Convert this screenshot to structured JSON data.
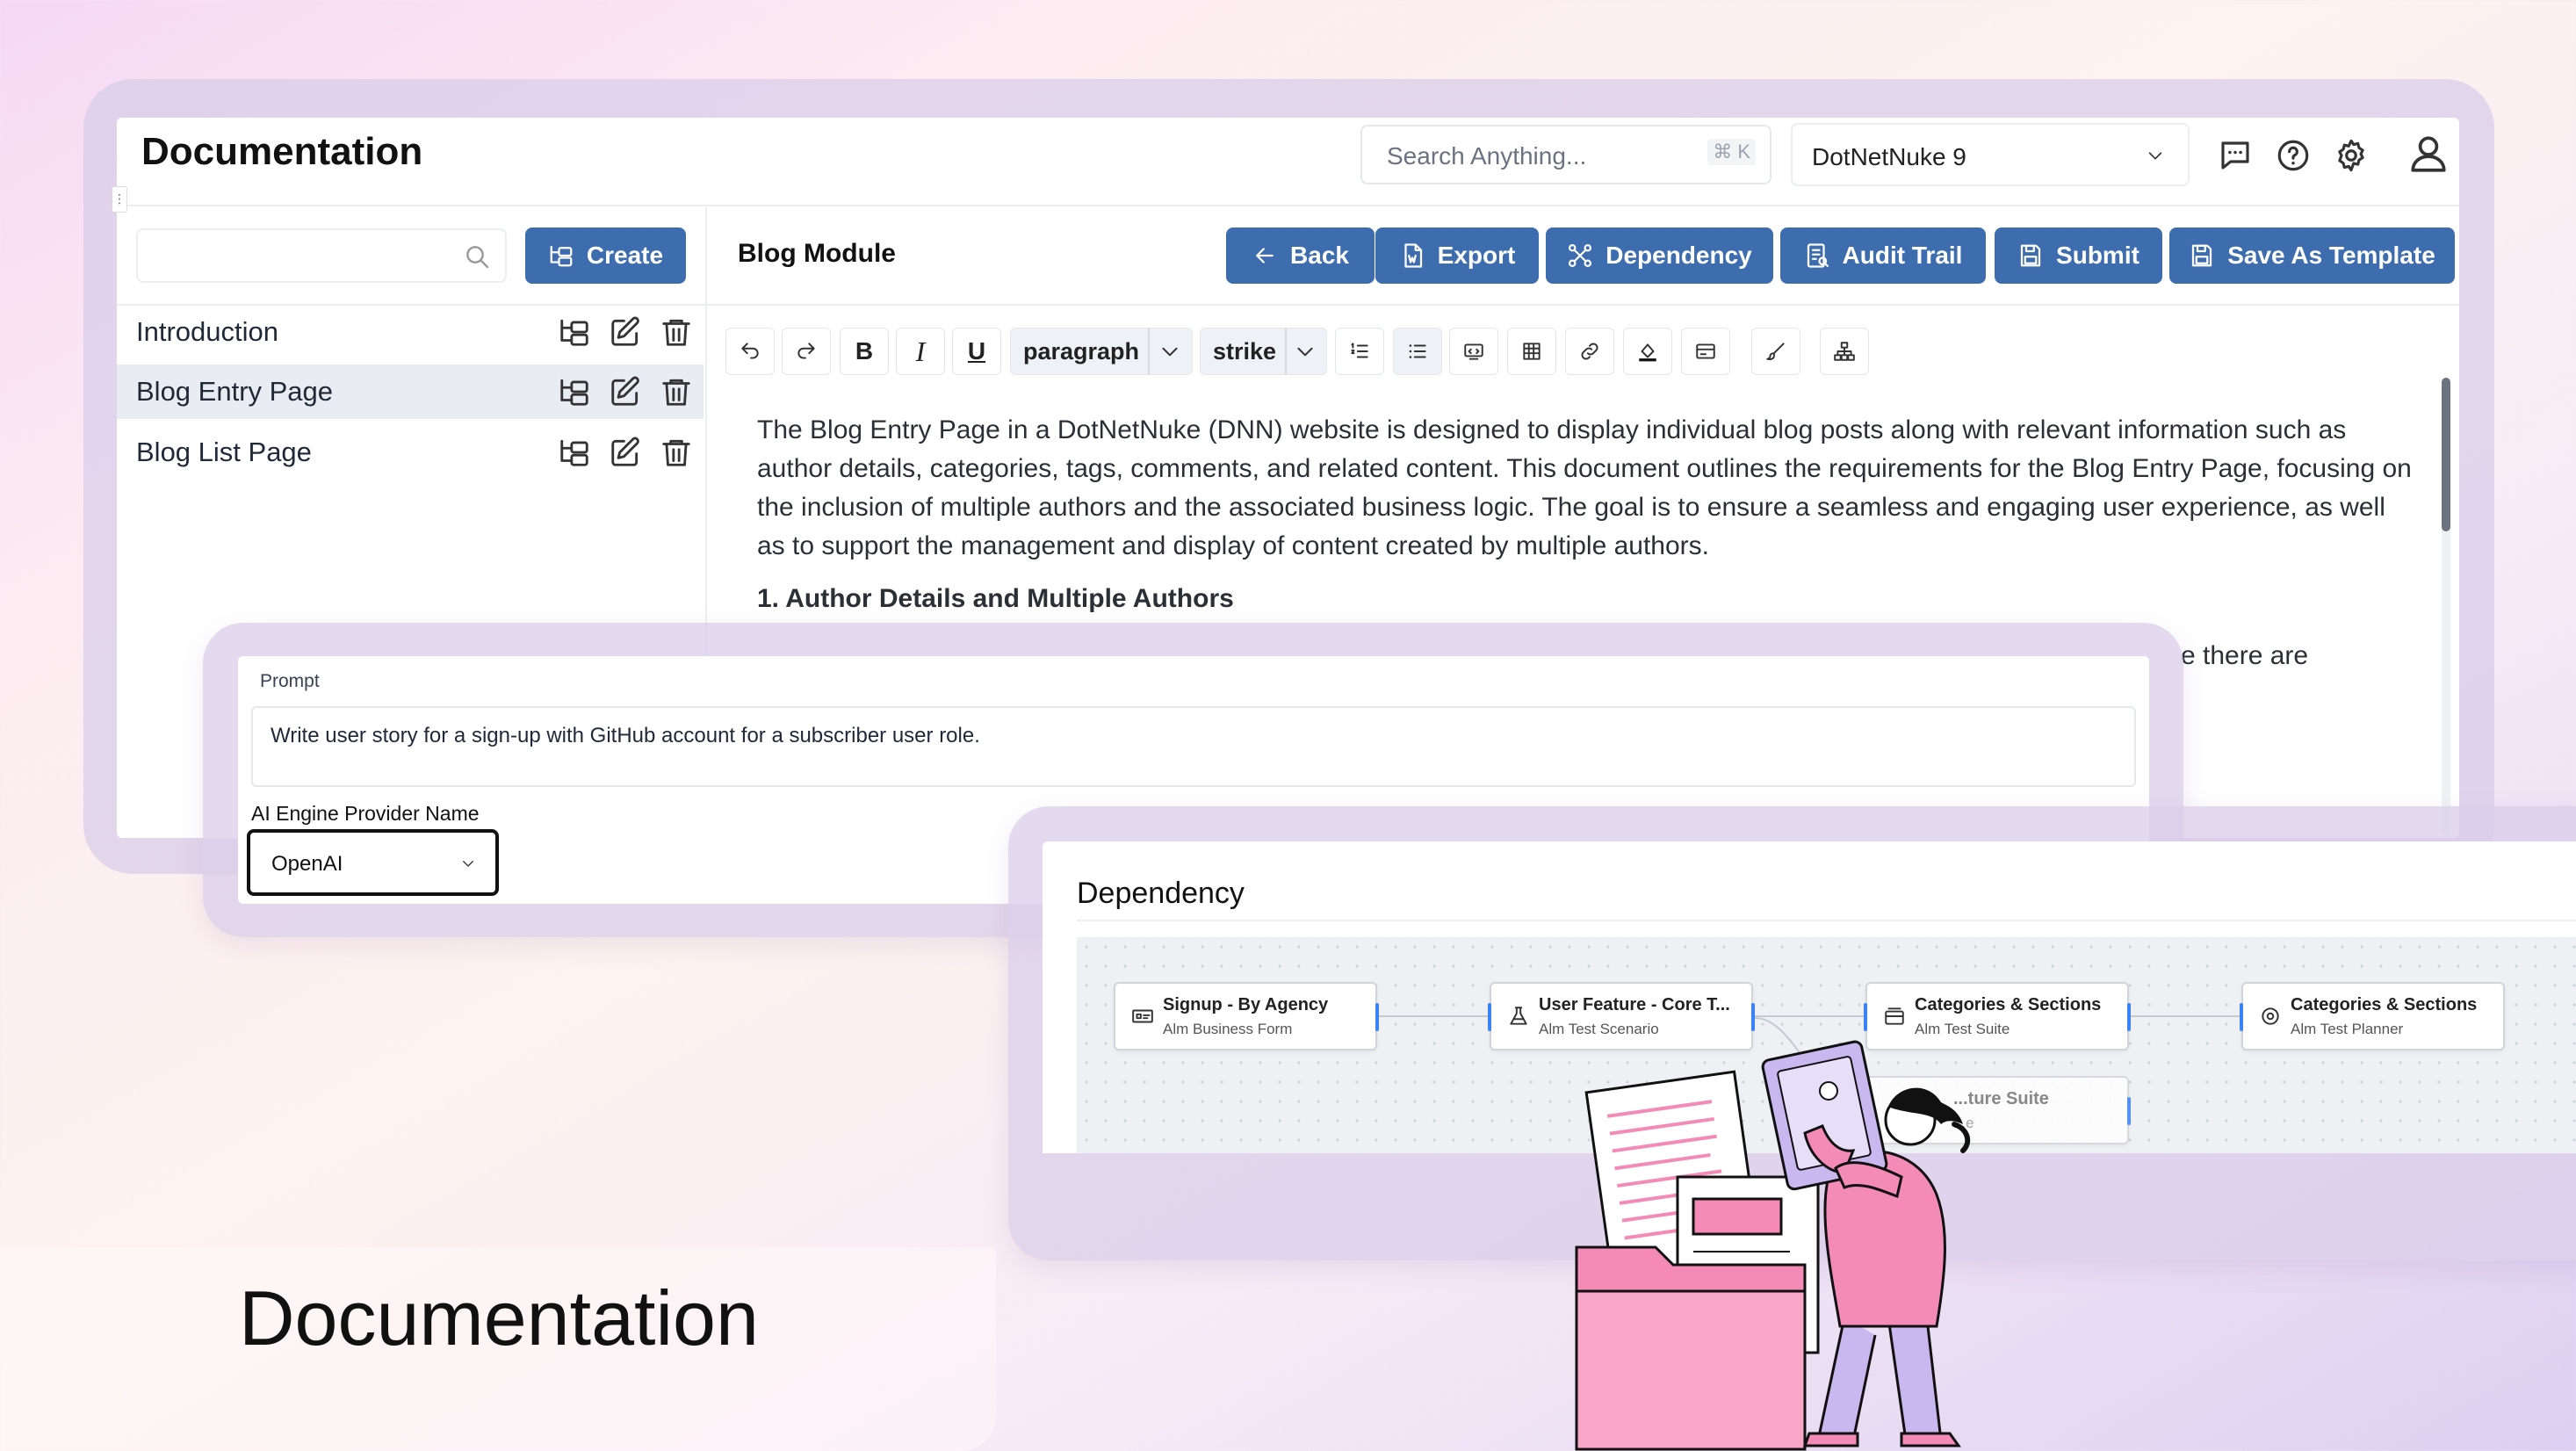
{
  "app": {
    "title": "Documentation",
    "search_placeholder": "Search Anything...",
    "search_shortcut": "⌘ K",
    "project_select": "DotNetNuke 9"
  },
  "sidebar": {
    "create_label": "Create",
    "items": [
      {
        "label": "Introduction"
      },
      {
        "label": "Blog Entry Page"
      },
      {
        "label": "Blog List Page"
      }
    ]
  },
  "editor": {
    "module_title": "Blog Module",
    "actions": {
      "back": "Back",
      "export": "Export",
      "dependency": "Dependency",
      "audit_trail": "Audit Trail",
      "submit": "Submit",
      "save_as_template": "Save As Template"
    },
    "toolbar": {
      "block_format": "paragraph",
      "inline_format": "strike"
    },
    "body": {
      "paragraph": "The Blog Entry Page in a DotNetNuke (DNN) website is designed to display individual blog posts along with relevant information such as author details, categories, tags, comments, and related content. This document outlines the requirements for the Blog Entry Page, focusing on the inclusion of multiple authors and the associated business logic. The goal is to ensure a seamless and engaging user experience, as well as to support the management and display of content created by multiple authors.",
      "heading": "1. Author Details and Multiple Authors",
      "partial_line": "e there are"
    }
  },
  "prompt_card": {
    "prompt_label": "Prompt",
    "prompt_value": "Write user story for a sign-up with GitHub account for a subscriber user role.",
    "engine_label": "AI Engine Provider Name",
    "engine_value": "OpenAI"
  },
  "dependency_card": {
    "title": "Dependency",
    "nodes": [
      {
        "title": "Signup - By Agency",
        "subtitle": "Alm Business Form",
        "icon": "form-icon"
      },
      {
        "title": "User Feature - Core T...",
        "subtitle": "Alm Test Scenario",
        "icon": "flask-icon"
      },
      {
        "title": "Categories & Sections",
        "subtitle": "Alm Test Suite",
        "icon": "suite-icon"
      },
      {
        "title": "Categories & Sections",
        "subtitle": "Alm Test Planner",
        "icon": "target-icon"
      }
    ],
    "partial_node": {
      "title": "...ture Suite",
      "subtitle": "...e"
    }
  },
  "hero": {
    "caption": "Documentation"
  },
  "colors": {
    "accent": "#3d6dae",
    "illustration_pink": "#f38bb6",
    "illustration_lavender": "#c9b8f0"
  }
}
